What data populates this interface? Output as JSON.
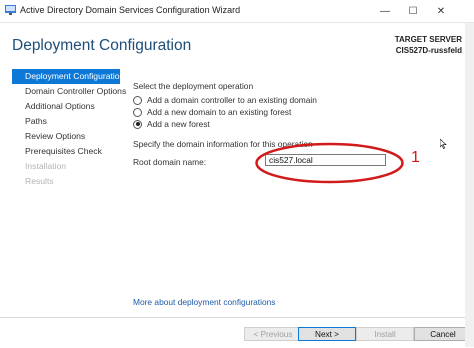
{
  "window": {
    "title": "Active Directory Domain Services Configuration Wizard",
    "minimize_glyph": "—",
    "maximize_glyph": "☐",
    "close_glyph": "✕"
  },
  "header": {
    "page_title": "Deployment Configuration",
    "target_label": "TARGET SERVER",
    "target_name": "CIS527D-russfeld"
  },
  "nav": {
    "items": [
      {
        "label": "Deployment Configuration",
        "state": "active"
      },
      {
        "label": "Domain Controller Options",
        "state": "enabled"
      },
      {
        "label": "Additional Options",
        "state": "enabled"
      },
      {
        "label": "Paths",
        "state": "enabled"
      },
      {
        "label": "Review Options",
        "state": "enabled"
      },
      {
        "label": "Prerequisites Check",
        "state": "enabled"
      },
      {
        "label": "Installation",
        "state": "disabled"
      },
      {
        "label": "Results",
        "state": "disabled"
      }
    ]
  },
  "main": {
    "operation_label": "Select the deployment operation",
    "options": [
      {
        "label": "Add a domain controller to an existing domain",
        "selected": false
      },
      {
        "label": "Add a new domain to an existing forest",
        "selected": false
      },
      {
        "label": "Add a new forest",
        "selected": true
      }
    ],
    "domain_info_label": "Specify the domain information for this operation",
    "root_domain_label": "Root domain name:",
    "root_domain_value": "cis527.local",
    "annotation_number": "1",
    "more_link": "More about deployment configurations"
  },
  "footer": {
    "previous": "< Previous",
    "next": "Next >",
    "install": "Install",
    "cancel": "Cancel"
  },
  "colors": {
    "accent": "#0e78d7",
    "title_blue": "#1e4e79",
    "annotation_red": "#d11a1a"
  },
  "icons": [
    "ad-ds-app-icon",
    "mouse-cursor-icon"
  ]
}
